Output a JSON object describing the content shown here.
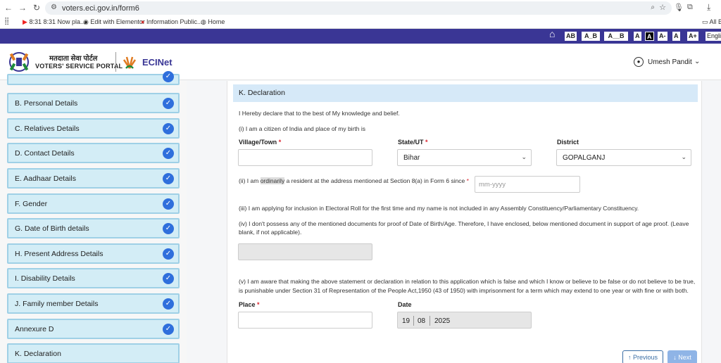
{
  "browser": {
    "url": "voters.eci.gov.in/form6",
    "bookmarks": [
      "8:31 8:31 Now pla...",
      "Edit with Elementor",
      "Information Public...",
      "Home"
    ],
    "all_bookmarks": "All B"
  },
  "accessibility": {
    "items": [
      "AB",
      "A_B",
      "A__B",
      "A",
      "A",
      "A-",
      "A",
      "A+"
    ],
    "lang": "Engli"
  },
  "header": {
    "hindi_title": "मतदाता सेवा पोर्टल",
    "portal_name": "VOTERS' SERVICE PORTAL",
    "ecinet": "ECINet",
    "user": "Umesh Pandit"
  },
  "sidebar": {
    "items": [
      {
        "label": "B. Personal Details",
        "done": true
      },
      {
        "label": "C. Relatives Details",
        "done": true
      },
      {
        "label": "D. Contact Details",
        "done": true
      },
      {
        "label": "E. Aadhaar Details",
        "done": true
      },
      {
        "label": "F. Gender",
        "done": true
      },
      {
        "label": "G. Date of Birth details",
        "done": true
      },
      {
        "label": "H. Present Address Details",
        "done": true
      },
      {
        "label": "I. Disability Details",
        "done": true
      },
      {
        "label": "J. Family member Details",
        "done": true
      },
      {
        "label": "Annexure D",
        "done": true
      },
      {
        "label": "K. Declaration",
        "done": false
      }
    ]
  },
  "form": {
    "title": "K. Declaration",
    "intro": "I Hereby declare that to the best of My knowledge and belief.",
    "c1": "(i) I am a citizen of India and place of my birth is",
    "village_label": "Village/Town",
    "village_value": "",
    "state_label": "State/UT",
    "state_value": "Bihar",
    "district_label": "District",
    "district_value": "GOPALGANJ",
    "c2_a": "(ii) I am ",
    "c2_hl": "ordinarily",
    "c2_b": " a resident at the address mentioned at Section 8(a) in Form 6 since",
    "c2_placeholder": "mm-yyyy",
    "c3": "(iii) I am applying for inclusion in Electoral Roll for the first time and my name is not included in any Assembly Constituency/Parliamentary Constituency.",
    "c4_l1": "(iv) I don't possess any of the mentioned documents for proof of Date of Birth/Age. Therefore, I have enclosed, below mentioned document in support of age proof. (Leave",
    "c4_l2": "blank, if not applicable).",
    "c5_l1": "(v) I am aware that making the above statement or declaration in relation to this application which is false and which I know or believe to be false or do not believe to be true,",
    "c5_l2": "is punishable under Section 31 of Representation of the People Act,1950 (43 of 1950) with imprisonment for a term which may extend to one year or with fine or with both.",
    "place_label": "Place",
    "place_value": "",
    "date_label": "Date",
    "date_d": "19",
    "date_m": "08",
    "date_y": "2025",
    "prev": "↑ Previous",
    "next": "↓ Next"
  },
  "colors": {
    "accent": "#3a3695",
    "sidebar_bg": "#d3edf6",
    "check": "#2f6fdc",
    "section_bg": "#d6e9f8"
  }
}
